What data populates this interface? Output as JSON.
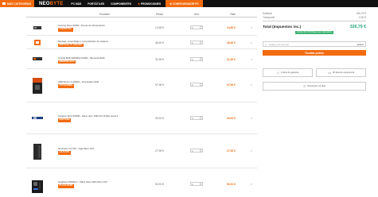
{
  "nav": {
    "categories_label": "MÁS CATEGORÍAS",
    "logo_main": "NEO",
    "logo_accent": "BYTE",
    "items": [
      "PC MÁS",
      "PORTÁTILES",
      "COMPONENTES",
      "PROMOCIONES"
    ],
    "configurator_label": "CONFIGURADOR PC"
  },
  "table": {
    "headers": {
      "product": "Producto",
      "price": "Precio",
      "qty": "Unit.",
      "total": "Total"
    }
  },
  "products": [
    {
      "name": "Gaming Nano 500W - Fuente de alimentación",
      "badge": "FUENTE 80+",
      "price": "14,90 €",
      "qty": "1",
      "total": "14,90 €",
      "icon": "power-supply"
    },
    {
      "name": "Montaje, ensamblaje y comprobación de equipos",
      "badge": "MONTAJE PC SEGURO",
      "price": "48,40 €",
      "qty": "1",
      "total": "48,40 €",
      "icon": "assembly-service"
    },
    {
      "name": "Crucial 8GB 3200MHz DDR4 - Memoria RAM",
      "badge": "MEMORIA RAM",
      "price": "31,90 €",
      "qty": "1",
      "total": "31,90 €",
      "icon": "ram"
    },
    {
      "name": "AMD Ryzen 5 4600G - Procesador AM4",
      "badge": "CPU/GAMING",
      "price": "97,90 €",
      "qty": "1",
      "total": "97,90 €",
      "icon": "cpu-box"
    },
    {
      "name": "Kingston NV2 500GB - Disco duro SSD M.2 NVMe Gen4 4",
      "badge": "SSD NVMe",
      "price": "39,91 €",
      "qty": "1",
      "total": "39,91 €",
      "icon": "ssd"
    },
    {
      "name": "NeoCase CX-700 - Caja Micro-ATX",
      "badge": "CAJA ATX",
      "price": "27,90 €",
      "qty": "1",
      "total": "27,90 €",
      "icon": "pc-case"
    },
    {
      "name": "Gigabyte A520M-H - Placa base AM4 Micro-ATX",
      "badge": "PLACA BASE",
      "price": "53,91 €",
      "qty": "1",
      "total": "53,91 €",
      "icon": "motherboard"
    }
  ],
  "delete_icon": "trash-icon",
  "summary": {
    "subtotal_label": "Subtotal",
    "subtotal_value": "326,79 €",
    "shipping_label": "Transporte",
    "shipping_value": "0,00 €",
    "total_label": "Total (Impuestos inc.)",
    "total_value": "326,79 €",
    "savings_badge": "Ahorrá 26,73 € Pasa a ser más activo",
    "coupon_placeholder": "Código promocional",
    "coupon_apply": "Aplicar",
    "checkout_label": "Tramitar pedido",
    "features": [
      "3 años de garantía",
      "30 días de experiencia"
    ],
    "returns_label": "Devolución 14 días"
  },
  "colors": {
    "accent": "#f26b0f",
    "total_green": "#1fa27a",
    "badge_green": "#3cb371",
    "nav_bg": "#111111"
  }
}
